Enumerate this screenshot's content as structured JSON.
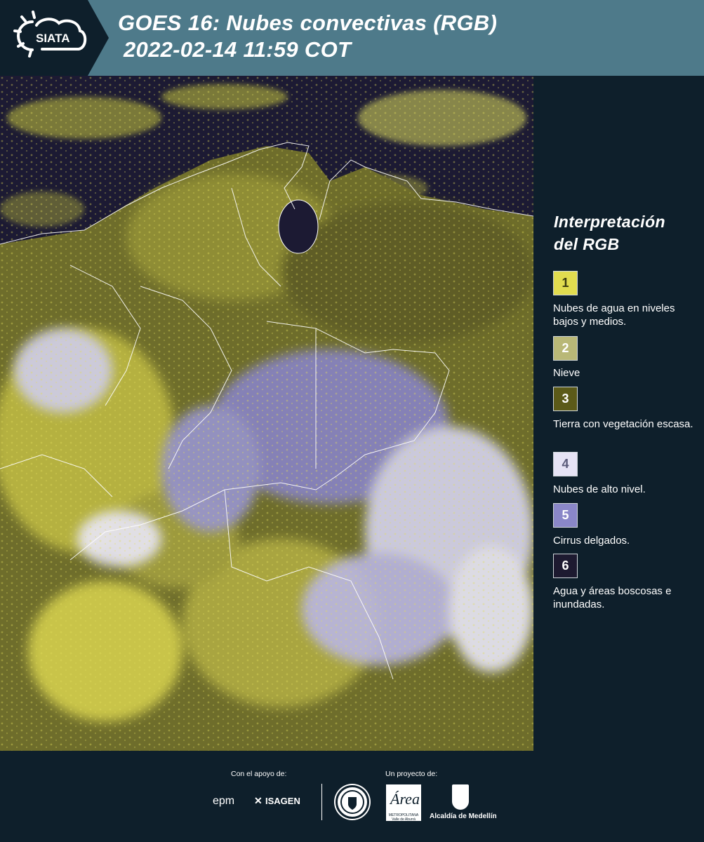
{
  "header": {
    "logo_text": "SIATA",
    "title_line1": "GOES 16: Nubes convectivas (RGB)",
    "title_line2": "2022-02-14 11:59 COT"
  },
  "legend": {
    "title_line1": "Interpretación",
    "title_line2": "del RGB",
    "items": [
      {
        "num": "1",
        "color": "#e1dc4f",
        "text_color": "#3a3a10",
        "label": "Nubes de agua en niveles bajos y medios."
      },
      {
        "num": "2",
        "color": "#b9b877",
        "text_color": "#ffffff",
        "label": "Nieve"
      },
      {
        "num": "3",
        "color": "#5b5a19",
        "text_color": "#ffffff",
        "label": "Tierra con vegetación escasa."
      },
      {
        "num": "4",
        "color": "#e6e3f5",
        "text_color": "#5a5a7a",
        "label": "Nubes de alto nivel."
      },
      {
        "num": "5",
        "color": "#8a87c8",
        "text_color": "#ffffff",
        "label": "Cirrus delgados."
      },
      {
        "num": "6",
        "color": "#1d1a30",
        "text_color": "#ffffff",
        "label": "Agua y áreas boscosas e inundadas."
      }
    ]
  },
  "footer": {
    "support_label": "Con el apoyo de:",
    "project_label": "Un proyecto de:",
    "sponsor_epm": "epm",
    "sponsor_isagen": "ISAGEN",
    "partner_area_line1": "METROPOLITANA",
    "partner_area_line2": "Valle de Aburrá",
    "partner_alcaldia": "Alcaldía de Medellín"
  },
  "colors": {
    "header_bg": "#4e7a8a",
    "panel_bg": "#0e1f2b",
    "map_dark": "#1c1a33",
    "cloud_yellow": "#d9d54a",
    "cloud_white": "#e9e7f7",
    "cirrus_violet": "#8884c6"
  }
}
